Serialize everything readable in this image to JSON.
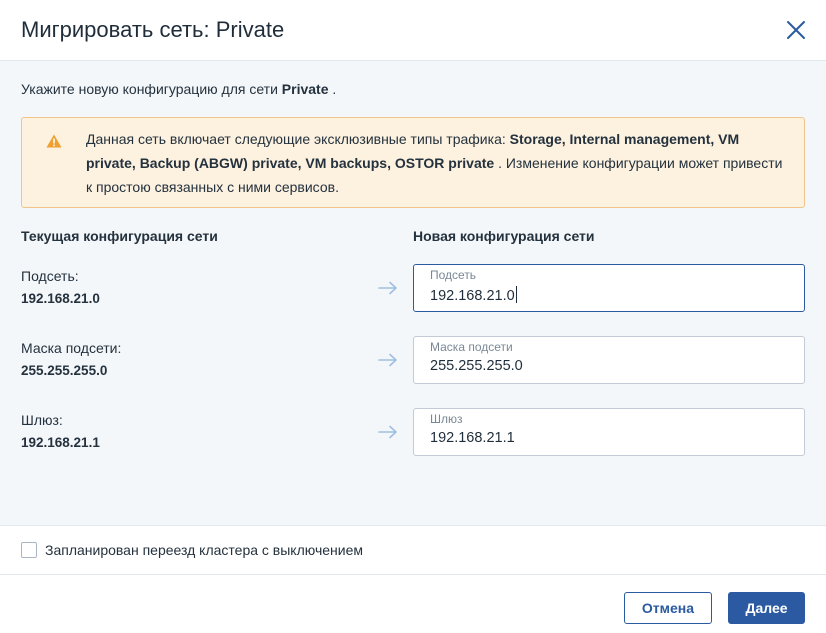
{
  "dialog": {
    "title": "Мигрировать сеть: Private",
    "close_icon": "close-icon"
  },
  "intro": {
    "prefix": "Укажите новую конфигурацию для сети ",
    "network": "Private",
    "suffix": " ."
  },
  "warning": {
    "icon": "warning-triangle-icon",
    "prefix": "Данная сеть включает следующие эксклюзивные типы трафика: ",
    "traffic_types": "Storage, Internal management, VM private, Backup (ABGW) private, VM backups, OSTOR private",
    "suffix": " . Изменение конфигурации может привести к простою связанных с ними сервисов.",
    "colors": {
      "background": "#fdf1df",
      "border": "#f0c48a",
      "icon": "#f0a030"
    }
  },
  "current": {
    "heading": "Текущая конфигурация сети",
    "subnet_label": "Подсеть:",
    "subnet_value": "192.168.21.0",
    "mask_label": "Маска подсети:",
    "mask_value": "255.255.255.0",
    "gateway_label": "Шлюз:",
    "gateway_value": "192.168.21.1"
  },
  "new": {
    "heading": "Новая конфигурация сети",
    "subnet_label": "Подсеть",
    "subnet_value": "192.168.21.0",
    "mask_label": "Маска подсети",
    "mask_value": "255.255.255.0",
    "gateway_label": "Шлюз",
    "gateway_value": "192.168.21.1"
  },
  "arrow_icon": "arrow-right-icon",
  "schedule": {
    "checked": false,
    "label": "Запланирован переезд кластера с выключением"
  },
  "buttons": {
    "cancel": "Отмена",
    "next": "Далее"
  },
  "colors": {
    "accent": "#2b5aa3",
    "body_background": "#f4f7fa"
  }
}
